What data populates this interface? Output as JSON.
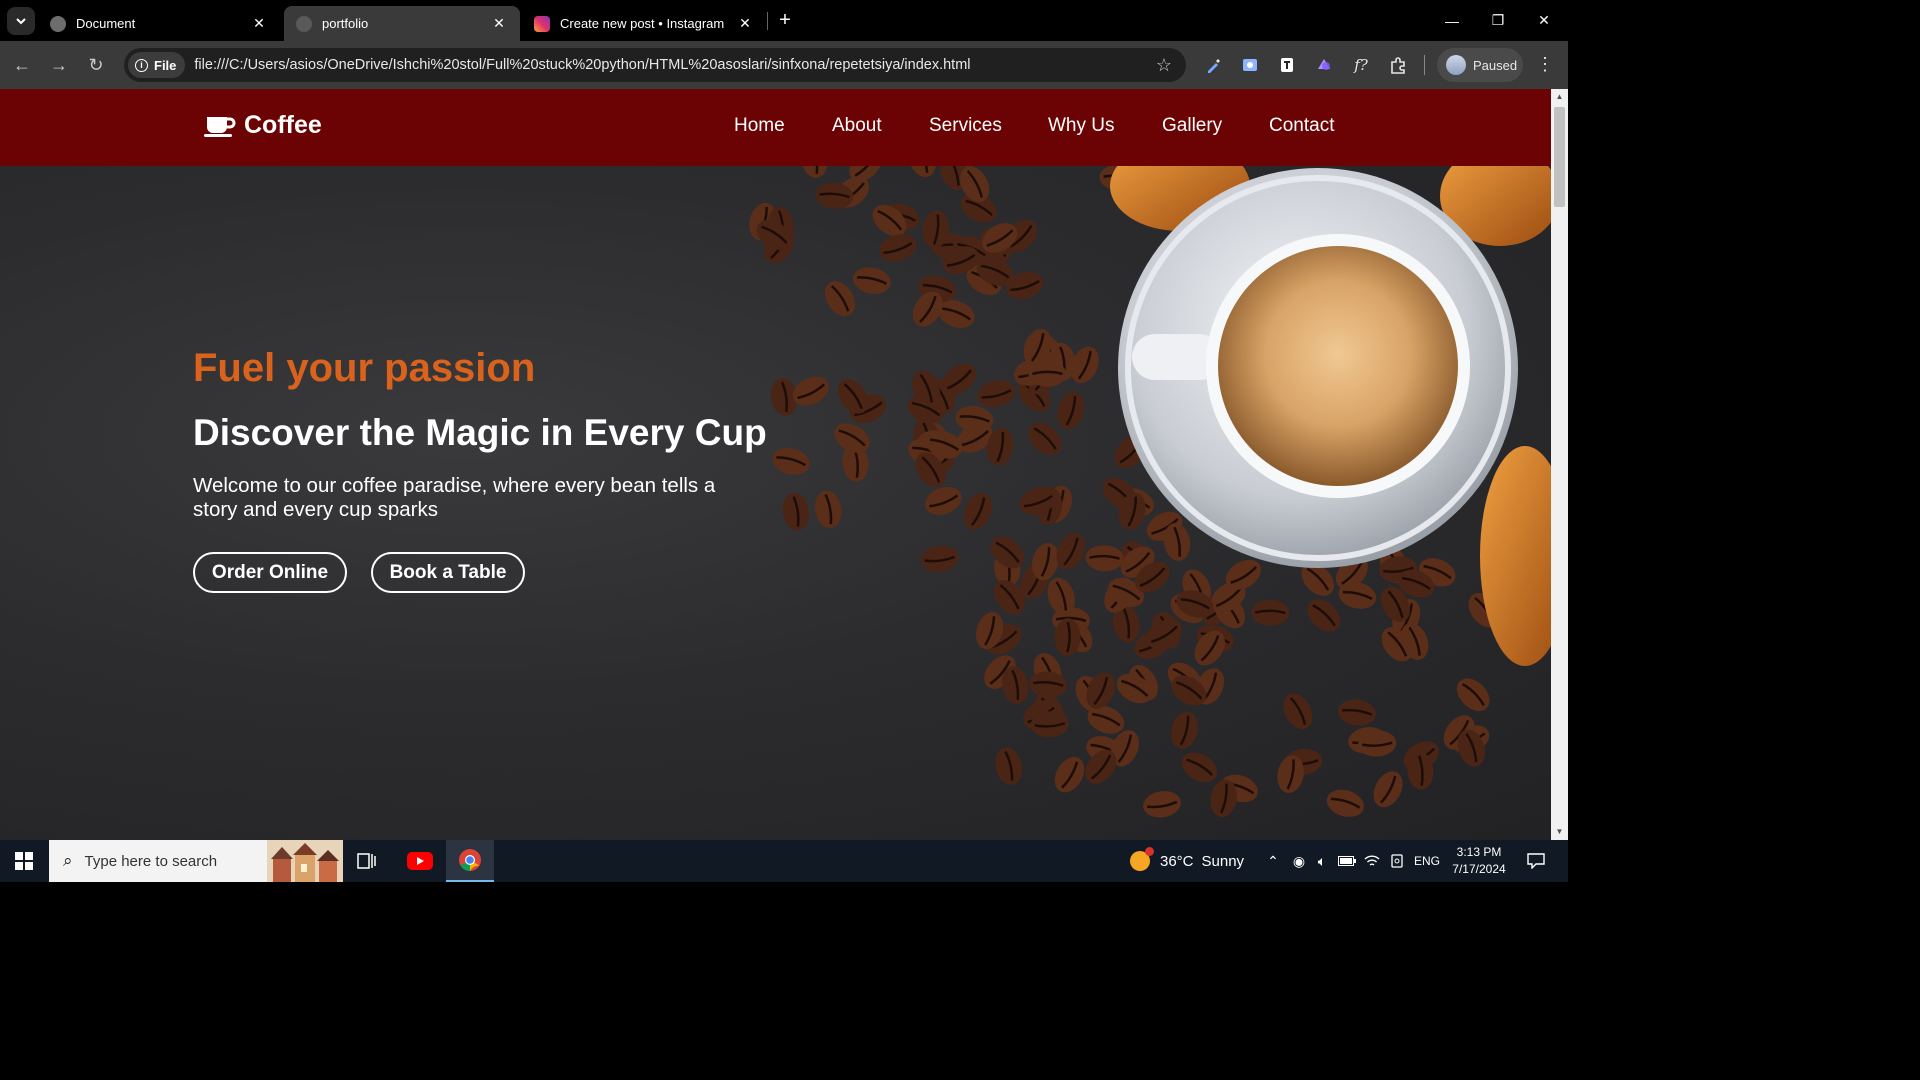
{
  "browser": {
    "tabs": [
      {
        "title": "Document",
        "active": false
      },
      {
        "title": "portfolio",
        "active": true
      },
      {
        "title": "Create new post • Instagram",
        "active": false
      }
    ],
    "address": {
      "chip_label": "File",
      "url": "file:///C:/Users/asios/OneDrive/Ishchi%20stol/Full%20stuck%20python/HTML%20asoslari/sinfxona/repetetsiya/index.html"
    },
    "profile_label": "Paused"
  },
  "site": {
    "logo_text": "Coffee",
    "nav": [
      "Home",
      "About",
      "Services",
      "Why Us",
      "Gallery",
      "Contact"
    ],
    "hero": {
      "tagline": "Fuel your passion",
      "headline": "Discover the Magic in Every Cup",
      "lead": "Welcome to our coffee paradise, where every bean tells a story and every cup sparks",
      "buttons": [
        "Order Online",
        "Book a Table"
      ]
    },
    "colors": {
      "header": "#6b0203",
      "accent": "#d9631d"
    }
  },
  "taskbar": {
    "search_placeholder": "Type here to search",
    "weather": {
      "temp": "36°C",
      "condition": "Sunny"
    },
    "language": "ENG",
    "time": "3:13 PM",
    "date": "7/17/2024"
  }
}
